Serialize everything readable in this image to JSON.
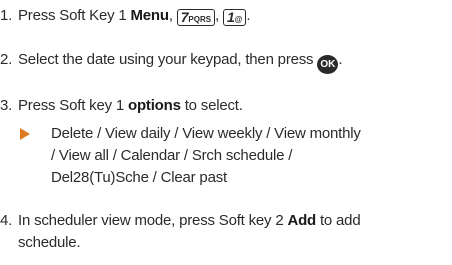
{
  "steps": [
    {
      "number": "1.",
      "prefix": "Press Soft Key 1 ",
      "bold": "Menu",
      "sep": ",",
      "key1_main": "7",
      "key1_sub": "PQRS",
      "key2_main": "1",
      "key2_sub": "@",
      "end": "."
    },
    {
      "number": "2.",
      "text": "Select the date using your keypad, then press",
      "ok_label": "OK",
      "end": "."
    },
    {
      "number": "3.",
      "prefix": "Press Soft key 1 ",
      "bold": "options",
      "suffix": " to select."
    },
    {
      "bullet_lines": [
        "Delete / View daily / View weekly / View monthly",
        "/ View all / Calendar / Srch schedule /",
        "Del28(Tu)Sche / Clear past"
      ]
    },
    {
      "number": "4.",
      "prefix": "In scheduler view mode, press Soft key 2 ",
      "bold": "Add",
      "suffix": " to add",
      "line2": "schedule."
    }
  ],
  "colors": {
    "text": "#2b2b2b",
    "bullet": "#e07a1f"
  },
  "icons": {
    "bullet": "triangle-right-icon",
    "ok": "ok-button-icon"
  }
}
